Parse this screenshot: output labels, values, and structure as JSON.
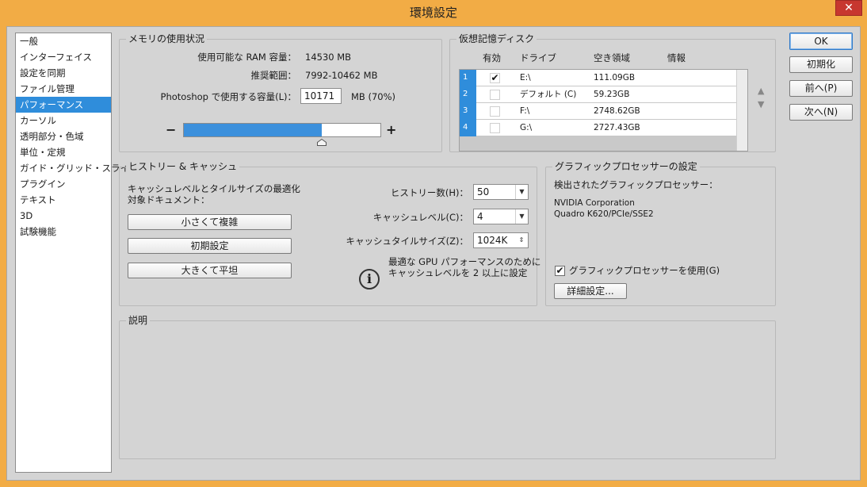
{
  "window": {
    "title": "環境設定",
    "close_glyph": "✕"
  },
  "sidebar": {
    "items": [
      {
        "label": "一般"
      },
      {
        "label": "インターフェイス"
      },
      {
        "label": "設定を同期"
      },
      {
        "label": "ファイル管理"
      },
      {
        "label": "パフォーマンス",
        "selected": true
      },
      {
        "label": "カーソル"
      },
      {
        "label": "透明部分・色域"
      },
      {
        "label": "単位・定規"
      },
      {
        "label": "ガイド・グリッド・スライス"
      },
      {
        "label": "プラグイン"
      },
      {
        "label": "テキスト"
      },
      {
        "label": "3D"
      },
      {
        "label": "試験機能"
      }
    ]
  },
  "memory": {
    "legend": "メモリの使用状況",
    "available_label": "使用可能な RAM 容量：",
    "available_value": "14530 MB",
    "range_label": "推奨範囲：",
    "range_value": "7992-10462 MB",
    "use_label": "Photoshop で使用する容量(L)：",
    "use_value": "10171",
    "use_percent": "MB (70%)",
    "slider_minus": "−",
    "slider_plus": "+",
    "slider_fraction": 0.7
  },
  "scratch": {
    "legend": "仮想記憶ディスク",
    "columns": [
      "有効",
      "ドライブ",
      "空き領域",
      "情報"
    ],
    "rows": [
      {
        "num": "1",
        "checked": "✔",
        "drive": "E:\\",
        "free": "111.09GB",
        "info": ""
      },
      {
        "num": "2",
        "checked": "",
        "drive": "デフォルト (C)",
        "free": "59.23GB",
        "info": ""
      },
      {
        "num": "3",
        "checked": "",
        "drive": "F:\\",
        "free": "2748.62GB",
        "info": ""
      },
      {
        "num": "4",
        "checked": "",
        "drive": "G:\\",
        "free": "2727.43GB",
        "info": ""
      }
    ],
    "up_glyph": "▲",
    "down_glyph": "▼"
  },
  "history": {
    "legend": "ヒストリー & キャッシュ",
    "optimize_text_1": "キャッシュレベルとタイルサイズの最適化",
    "optimize_text_2": "対象ドキュメント：",
    "btn_small": "小さくて複雑",
    "btn_default": "初期設定",
    "btn_large": "大きくて平坦",
    "states_label": "ヒストリー数(H)：",
    "states_value": "50",
    "cache_label": "キャッシュレベル(C)：",
    "cache_value": "4",
    "tile_label": "キャッシュタイルサイズ(Z)：",
    "tile_value": "1024K",
    "tip_1": "最適な GPU パフォーマンスのために",
    "tip_2": "キャッシュレベルを 2 以上に設定",
    "info_glyph": "i"
  },
  "gpu": {
    "legend": "グラフィックプロセッサーの設定",
    "detected_label": "検出されたグラフィックプロセッサー：",
    "vendor": "NVIDIA Corporation",
    "model": "Quadro K620/PCIe/SSE2",
    "use_gpu_label": "グラフィックプロセッサーを使用(G)",
    "use_gpu_check": "✔",
    "advanced_button": "詳細設定..."
  },
  "description": {
    "legend": "説明"
  },
  "buttons": {
    "ok": "OK",
    "reset": "初期化",
    "prev": "前へ(P)",
    "next": "次へ(N)"
  },
  "colors": {
    "accent": "#2f8ddb",
    "titlebar": "#f2ac45",
    "panel": "#d4d4d4"
  }
}
